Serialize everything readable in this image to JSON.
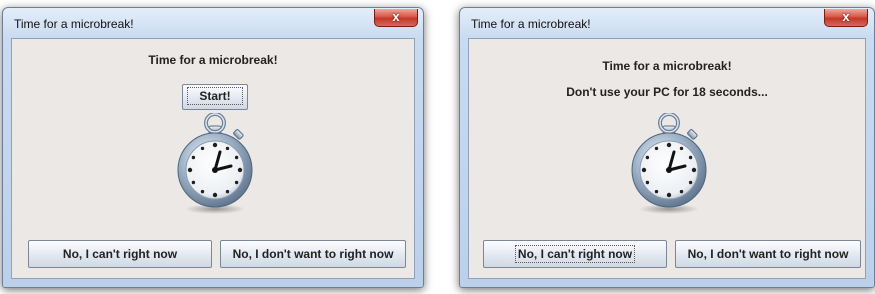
{
  "windows": [
    {
      "title": "Time for a microbreak!",
      "close_label": "x",
      "heading": "Time for a microbreak!",
      "start_label": "Start!",
      "btn_cant": "No, I can't right now",
      "btn_dont": "No, I don't want to right now",
      "icon": "stopwatch-icon"
    },
    {
      "title": "Time for a microbreak!",
      "close_label": "x",
      "heading": "Time for a microbreak!",
      "message": "Don't use your PC for 18 seconds...",
      "btn_cant": "No, I can't right now",
      "btn_dont": "No, I don't want to right now",
      "icon": "stopwatch-icon"
    }
  ]
}
